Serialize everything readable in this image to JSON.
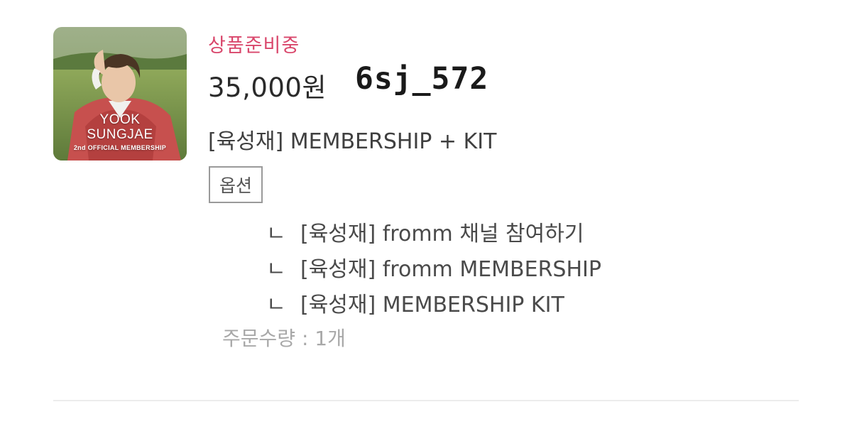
{
  "product": {
    "thumbnail": {
      "brand_line1": "YOOK",
      "brand_line2": "SUNGJAE",
      "brand_line3": "2nd OFFICIAL MEMBERSHIP"
    },
    "status": "상품준비중",
    "price": "35,000원",
    "handle": "6sj_572",
    "name": "[육성재] MEMBERSHIP + KIT",
    "option_badge": "옵션",
    "sub_option_marker": "ㄴ",
    "options": [
      "[육성재] fromm 채널 참여하기",
      "[육성재] fromm MEMBERSHIP",
      "[육성재] MEMBERSHIP KIT"
    ],
    "quantity": "주문수량 : 1개"
  },
  "colors": {
    "status": "#d9466b",
    "price": "#2a2a2a",
    "text": "#3f3f3f",
    "muted": "#a8a8a8",
    "divider": "#ececec"
  }
}
